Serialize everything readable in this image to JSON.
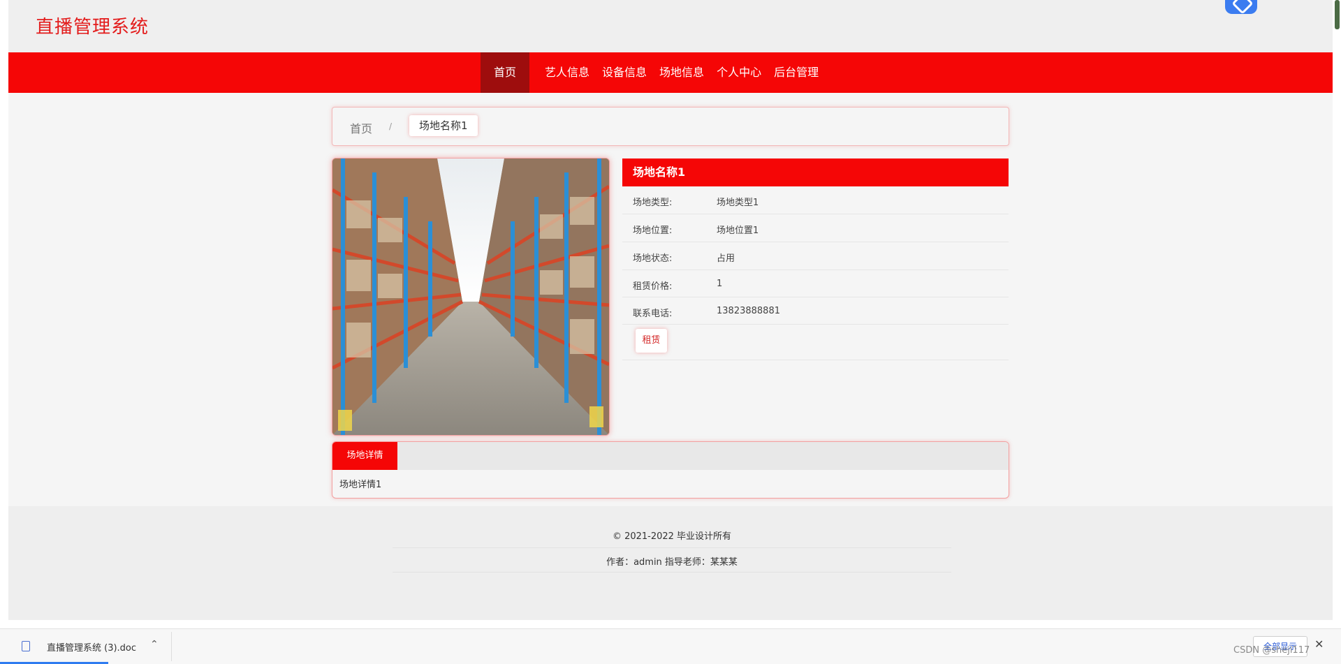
{
  "header": {
    "site_title": "直播管理系统"
  },
  "nav": {
    "items": [
      "首页",
      "艺人信息",
      "设备信息",
      "场地信息",
      "个人中心",
      "后台管理"
    ],
    "active_index": 0
  },
  "breadcrumb": {
    "home": "首页",
    "separator": "/",
    "current": "场地名称1"
  },
  "venue": {
    "title": "场地名称1",
    "fields": [
      {
        "label": "场地类型:",
        "value": "场地类型1"
      },
      {
        "label": "场地位置:",
        "value": "场地位置1"
      },
      {
        "label": "场地状态:",
        "value": "占用"
      },
      {
        "label": "租赁价格:",
        "value": "1"
      },
      {
        "label": "联系电话:",
        "value": "13823888881"
      }
    ],
    "rent_button": "租赁"
  },
  "detail": {
    "tab_label": "场地详情",
    "content": "场地详情1"
  },
  "footer": {
    "copyright": "© 2021-2022 毕业设计所有",
    "author": "作者：admin 指导老师：某某某"
  },
  "download_bar": {
    "file_name": "直播管理系统 (3).doc",
    "show_all": "全部显示",
    "close": "✕"
  },
  "watermark": "CSDN @sheji117",
  "colors": {
    "primary_red": "#f50606",
    "nav_active": "#9e0d0d",
    "title_red": "#e31b1b"
  }
}
